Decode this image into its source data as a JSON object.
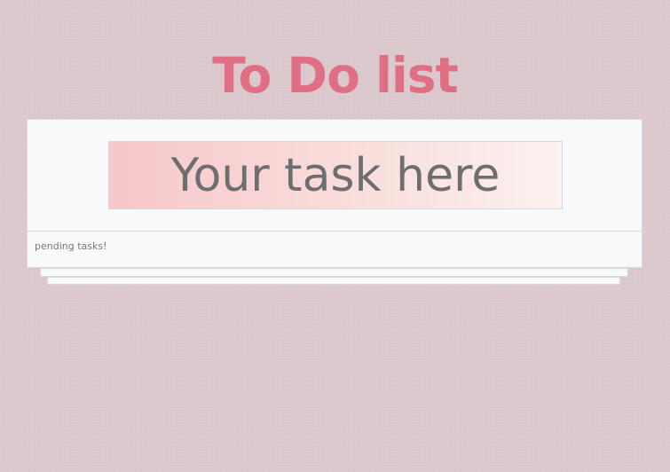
{
  "app": {
    "title": "To Do list"
  },
  "task_input": {
    "value": "",
    "placeholder": "Your task here"
  },
  "footer": {
    "pending_text": "pending tasks!"
  },
  "colors": {
    "background": "#dcc8cc",
    "title": "#e06f85",
    "card": "#f8f9fb",
    "input_gradient_start": "#f7c7ca",
    "input_gradient_end": "#fbf1ee"
  }
}
